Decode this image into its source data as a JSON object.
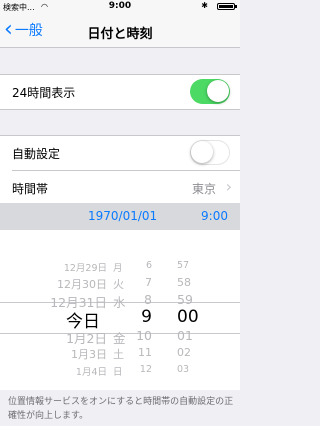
{
  "status_bar": {
    "carrier": "検索中...",
    "time": "9:00"
  },
  "nav": {
    "back_label": "一般",
    "title": "日付と時刻"
  },
  "settings": {
    "hour24": {
      "label": "24時間表示",
      "on": true
    },
    "auto": {
      "label": "自動設定",
      "on": false
    },
    "timezone": {
      "label": "時間帯",
      "value": "東京"
    }
  },
  "datetime_bar": {
    "date": "1970/01/01",
    "time": "9:00"
  },
  "picker": {
    "rows": [
      {
        "day": "12月29日",
        "wd": "月",
        "hour": "6",
        "min": "57"
      },
      {
        "day": "12月30日",
        "wd": "火",
        "hour": "7",
        "min": "58"
      },
      {
        "day": "12月31日",
        "wd": "水",
        "hour": "8",
        "min": "59"
      },
      {
        "day": "今日",
        "wd": "",
        "hour": "9",
        "min": "00"
      },
      {
        "day": "1月2日",
        "wd": "金",
        "hour": "10",
        "min": "01"
      },
      {
        "day": "1月3日",
        "wd": "土",
        "hour": "11",
        "min": "02"
      },
      {
        "day": "1月4日",
        "wd": "日",
        "hour": "12",
        "min": "03"
      }
    ]
  },
  "footer_note": "位置情報サービスをオンにすると時間帯の自動設定の正確性が向上します。"
}
